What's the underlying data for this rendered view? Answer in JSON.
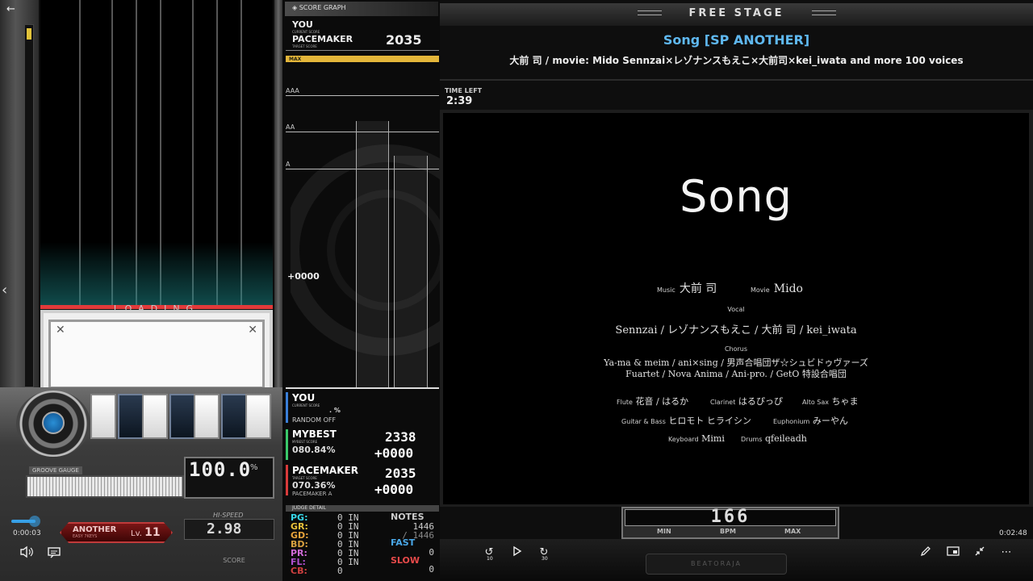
{
  "left": {
    "loading": "LOADING",
    "groove": {
      "label": "GROOVE GAUGE",
      "value": "100.0",
      "unit": "%"
    },
    "hispeed": {
      "label": "HI-SPEED",
      "value": "2.98"
    },
    "difficulty": {
      "name": "ANOTHER",
      "sub": "EASY 7KEYS",
      "level_label": "Lv.",
      "level": "11"
    },
    "score_label": "SCORE"
  },
  "video": {
    "current_time": "0:00:03",
    "end_time": "0:02:48",
    "progress_fraction": 0.018
  },
  "graph": {
    "title": "SCORE GRAPH",
    "you": {
      "label": "YOU",
      "sub": "CURRENT SCORE"
    },
    "pacemaker": {
      "label": "PACEMAKER",
      "sub": "TARGET SCORE",
      "value": "2035"
    },
    "max_label": "MAX",
    "grades": [
      "AAA",
      "AA",
      "A"
    ],
    "zero_label": "+0000"
  },
  "scores": {
    "you": {
      "label": "YOU",
      "sub": "CURRENT SCORE",
      "pct": ". %",
      "option": "RANDOM OFF"
    },
    "mybest": {
      "label": "MYBEST",
      "sub": "MYBEST SCORE",
      "pct": "080.84%",
      "score": "2338",
      "diff": "+0000"
    },
    "pacemaker": {
      "label": "PACEMAKER",
      "sub": "TARGET SCORE",
      "pct": "070.36%",
      "target": "PACEMAKER A",
      "score": "2035",
      "diff": "+0000"
    }
  },
  "judge": {
    "title": "JUDGE DETAIL",
    "rows": [
      {
        "label": "PG:",
        "value": "0 IN",
        "color": "#37d6e8"
      },
      {
        "label": "GR:",
        "value": "0 IN",
        "color": "#e8c23a"
      },
      {
        "label": "GD:",
        "value": "0 IN",
        "color": "#e8a23a"
      },
      {
        "label": "BD:",
        "value": "0 IN",
        "color": "#d8a040"
      },
      {
        "label": "PR:",
        "value": "0 IN",
        "color": "#d06ad8"
      },
      {
        "label": "FL:",
        "value": "0 IN",
        "color": "#b050d0"
      },
      {
        "label": "CB:",
        "value": "0",
        "color": "#d04040"
      }
    ],
    "notes_label": "NOTES",
    "notes_total": "1446",
    "notes_slash": "/ 1446",
    "fast_label": "FAST",
    "fast_value": "0",
    "slow_label": "SLOW",
    "slow_value": "0",
    "cb_value": "0"
  },
  "stage": {
    "title": "FREE STAGE",
    "song_title": "Song [SP ANOTHER]",
    "artist": "大前 司 / movie: Mido Sennzai×レゾナンスもえこ×大前司×kei_iwata and more 100 voices",
    "time_left_label": "TIME LEFT",
    "time_left": "2:39"
  },
  "bga": {
    "song": "Song",
    "music_label": "Music",
    "music": "大前 司",
    "movie_label": "Movie",
    "movie": "Mido",
    "vocal_label": "Vocal",
    "vocal": "Sennzai / レゾナンスもえこ / 大前 司 / kei_iwata",
    "chorus_label": "Chorus",
    "chorus_1": "Ya-ma & meim / ani×sing / 男声合唱団ザ☆シュビドゥヴァーズ",
    "chorus_2": "Fuartet / Nova Anima / Ani-pro. / GetO 特設合唱団",
    "flute_label": "Flute",
    "flute": "花音 / はるか",
    "clarinet_label": "Clarinet",
    "clarinet": "はるぴっぴ",
    "altosax_label": "Alto Sax",
    "altosax": "ちゃま",
    "guitar_label": "Guitar & Bass",
    "guitar": "ヒロモト ヒライシン",
    "euph_label": "Euphonium",
    "euph": "みーやん",
    "keyboard_label": "Keyboard",
    "keyboard": "Mimi",
    "drums_label": "Drums",
    "drums": "qfeileadh"
  },
  "bpm": {
    "value": "166",
    "min_label": "MIN",
    "label": "BPM",
    "max_label": "MAX"
  },
  "brand": "BEATORAJA",
  "controls": {
    "rewind": "10",
    "forward": "30"
  }
}
